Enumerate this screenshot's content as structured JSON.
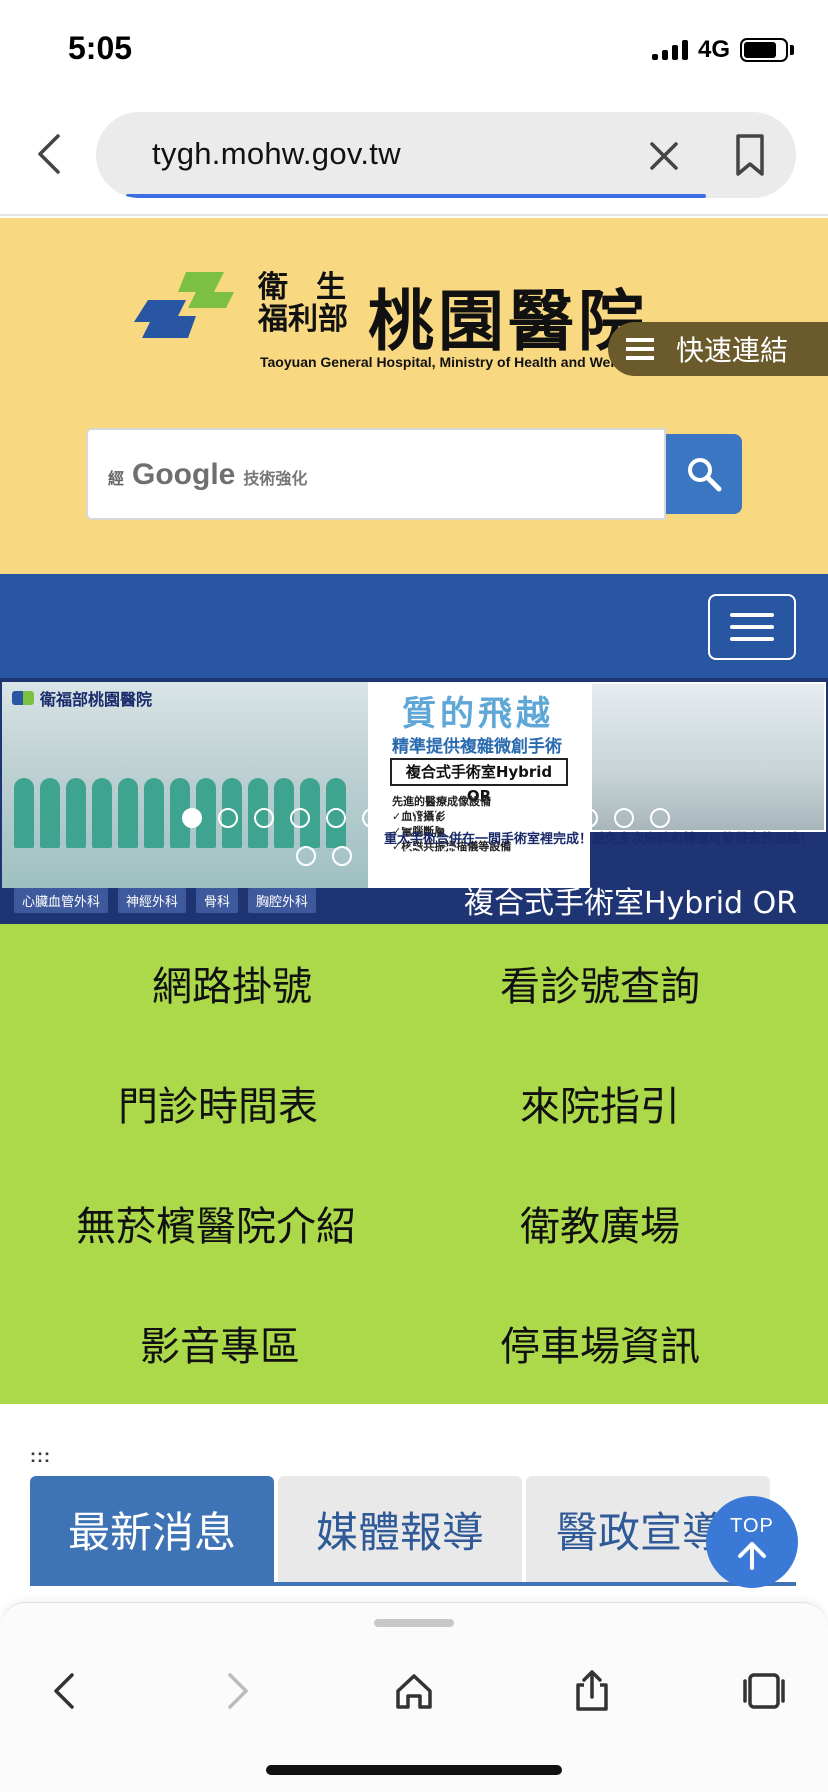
{
  "status_bar": {
    "time": "5:05",
    "network": "4G"
  },
  "browser": {
    "url": "tygh.mohw.gov.tw"
  },
  "header": {
    "logo_small_top_left": "衛",
    "logo_small_top_right": "生",
    "logo_small_bottom": "福利部",
    "logo_big": "桃園醫院",
    "logo_en": "Taoyuan General Hospital, Ministry of Health and Welfare",
    "quick_links_label": "快速連結",
    "search_prefix": "經",
    "search_google": "Google",
    "search_suffix": "技術強化"
  },
  "banner": {
    "brand": "衛福部桃園醫院",
    "title": "質的飛越",
    "subtitle": "精準提供複雜微創手術",
    "box": "複合式手術室Hybrid OR",
    "list": [
      "先進的醫療成像設備",
      "✓血管攝影",
      "✓電腦斷層",
      "✓核磁共振掃描儀等設備"
    ],
    "warning": "重大手術合併在一間手術室裡完成！避免多次麻醉和轉運可能帶來的風險！",
    "caption": "複合式手術室Hybrid OR",
    "tags": [
      "心臟血管外科",
      "神經外科",
      "骨科",
      "胸腔外科"
    ],
    "slide_count": 19,
    "active_slide": 1
  },
  "quick_menu": [
    "網路掛號",
    "看診號查詢",
    "門診時間表",
    "來院指引",
    "無菸檳醫院介紹",
    "衛教廣場",
    "影音專區",
    "停車場資訊"
  ],
  "accesskey": ":::",
  "tabs": [
    "最新消息",
    "媒體報導",
    "醫政宣導"
  ],
  "top_button": "TOP",
  "colors": {
    "header_bg": "#f8d982",
    "nav_bg": "#2956a2",
    "quick_menu_bg": "#abd94a",
    "tab_active": "#3e74b5",
    "accent": "#3a7ad6"
  }
}
